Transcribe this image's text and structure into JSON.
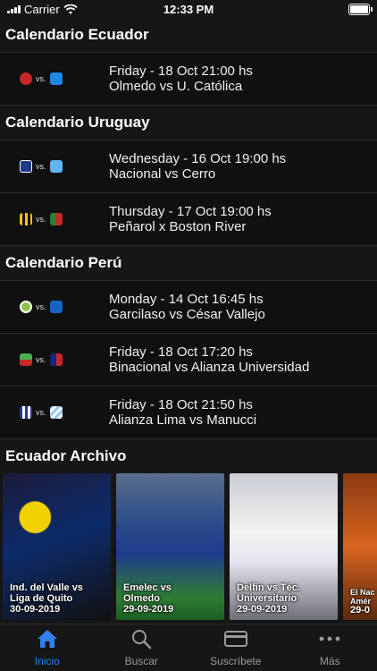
{
  "status_bar": {
    "carrier": "Carrier",
    "time": "12:33 PM"
  },
  "sections": [
    {
      "title": "Calendario Ecuador",
      "matches": [
        {
          "date": "Friday - 18 Oct 21:00 hs",
          "teams": "Olmedo vs U. Católica",
          "home_color": "#c62828",
          "away_color": "#1e88e5"
        }
      ]
    },
    {
      "title": "Calendario Uruguay",
      "matches": [
        {
          "date": "Wednesday - 16 Oct 19:00 hs",
          "teams": "Nacional vs Cerro",
          "home_color": "#1e3a8a",
          "away_color": "#64b5f6"
        },
        {
          "date": "Thursday - 17 Oct 19:00 hs",
          "teams": "Peñarol x Boston River",
          "home_color": "#f5c400",
          "away_color": "#2e7d32"
        }
      ]
    },
    {
      "title": "Calendario Perú",
      "matches": [
        {
          "date": "Monday - 14 Oct 16:45 hs",
          "teams": "Garcilaso vs César Vallejo",
          "home_color": "#8bc34a",
          "away_color": "#1565c0"
        },
        {
          "date": "Friday - 18 Oct 17:20 hs",
          "teams": "Binacional vs Alianza Universidad",
          "home_color": "#4caf50",
          "away_color": "#c62828"
        },
        {
          "date": "Friday - 18 Oct 21:50 hs",
          "teams": "Alianza Lima vs Manucci",
          "home_color": "#283593",
          "away_color": "#90caf9"
        }
      ]
    }
  ],
  "vs_label": "vs.",
  "archive": {
    "title": "Ecuador Archivo",
    "cards": [
      {
        "line1": "Ind. del Valle vs",
        "line2": "Liga de Quito",
        "date": "30-09-2019"
      },
      {
        "line1": "Emelec vs",
        "line2": "Olmedo",
        "date": "29-09-2019"
      },
      {
        "line1": "Delfín vs Téc.",
        "line2": "Universitario",
        "date": "29-09-2019"
      },
      {
        "line1": "El Nac",
        "line2": "Amér",
        "date": "29-0"
      }
    ]
  },
  "tabs": [
    {
      "label": "Inicio",
      "icon": "home-icon",
      "active": true
    },
    {
      "label": "Buscar",
      "icon": "search-icon",
      "active": false
    },
    {
      "label": "Suscríbete",
      "icon": "card-icon",
      "active": false
    },
    {
      "label": "Más",
      "icon": "more-icon",
      "active": false
    }
  ],
  "colors": {
    "accent": "#2f80ed",
    "background": "#161616",
    "row": "#101010"
  }
}
